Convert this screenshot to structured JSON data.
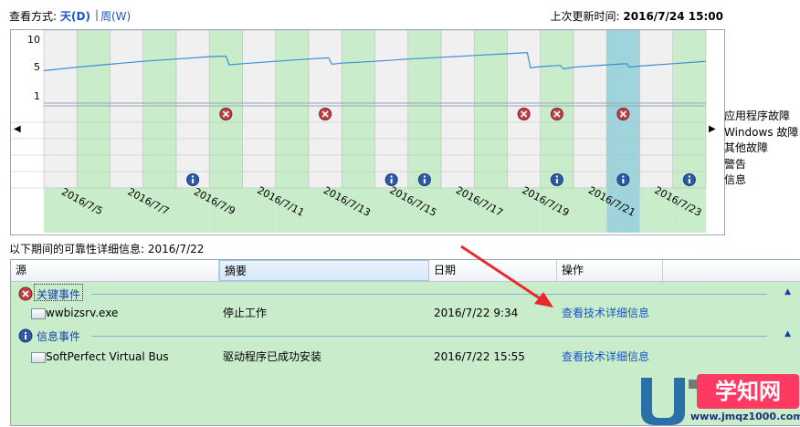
{
  "header": {
    "view_label": "查看方式:",
    "view_day": "天(D)",
    "view_sep": "|",
    "view_week": "周(W)",
    "last_update_label": "上次更新时间:",
    "last_update_value": "2016/7/24 15:00"
  },
  "chart_data": {
    "type": "line",
    "y_ticks": [
      "10",
      "5",
      "1"
    ],
    "ylim": [
      0,
      10
    ],
    "columns": 20,
    "selected_column": 17,
    "x_labels": [
      "2016/7/5",
      "2016/7/7",
      "2016/7/9",
      "2016/7/11",
      "2016/7/13",
      "2016/7/15",
      "2016/7/17",
      "2016/7/19",
      "2016/7/21",
      "2016/7/23"
    ],
    "stability_index": [
      {
        "x": 0,
        "y": 4.3
      },
      {
        "x": 1,
        "y": 4.9
      },
      {
        "x": 2,
        "y": 5.4
      },
      {
        "x": 3,
        "y": 5.9
      },
      {
        "x": 4,
        "y": 6.3
      },
      {
        "x": 5,
        "y": 6.7
      },
      {
        "x": 5.5,
        "y": 6.8
      },
      {
        "x": 5.6,
        "y": 5.3
      },
      {
        "x": 6,
        "y": 5.5
      },
      {
        "x": 7,
        "y": 5.9
      },
      {
        "x": 8,
        "y": 6.3
      },
      {
        "x": 8.6,
        "y": 6.5
      },
      {
        "x": 8.7,
        "y": 5.4
      },
      {
        "x": 9,
        "y": 5.6
      },
      {
        "x": 10,
        "y": 5.9
      },
      {
        "x": 11,
        "y": 6.3
      },
      {
        "x": 12,
        "y": 6.6
      },
      {
        "x": 13,
        "y": 6.9
      },
      {
        "x": 14,
        "y": 7.2
      },
      {
        "x": 14.6,
        "y": 7.4
      },
      {
        "x": 14.7,
        "y": 4.8
      },
      {
        "x": 15,
        "y": 5.0
      },
      {
        "x": 15.6,
        "y": 5.2
      },
      {
        "x": 15.7,
        "y": 4.6
      },
      {
        "x": 16,
        "y": 4.9
      },
      {
        "x": 17,
        "y": 5.3
      },
      {
        "x": 17.6,
        "y": 5.5
      },
      {
        "x": 17.7,
        "y": 4.9
      },
      {
        "x": 18,
        "y": 5.1
      },
      {
        "x": 19,
        "y": 5.5
      },
      {
        "x": 20,
        "y": 5.9
      }
    ],
    "categories": [
      "应用程序故障",
      "Windows 故障",
      "其他故障",
      "警告",
      "信息"
    ],
    "app_failures": [
      5,
      8,
      14,
      15,
      17
    ],
    "info_events": [
      4,
      10,
      11,
      15,
      17,
      19
    ],
    "line_color": "#3a8fd8",
    "green_color": "#c9ecca",
    "gray_color": "#f0f0f0",
    "selected_color": "#9fd4dc"
  },
  "nav": {
    "left": "◀",
    "right": "▶"
  },
  "details": {
    "title": "以下期间的可靠性详细信息: 2016/7/22",
    "columns": [
      "源",
      "摘要",
      "日期",
      "操作"
    ],
    "groups": [
      {
        "label": "关键事件",
        "caret": "▲",
        "row": {
          "source": "wwbizsrv.exe",
          "summary": "停止工作",
          "date": "2016/7/22 9:34",
          "action": "查看技术详细信息"
        }
      },
      {
        "label": "信息事件",
        "caret": "▲",
        "row": {
          "source": "SoftPerfect Virtual Bus",
          "summary": "驱动程序已成功安装",
          "date": "2016/7/22 15:55",
          "action": "查看技术详细信息"
        }
      }
    ]
  },
  "watermark": {
    "text": "学知网",
    "url": "www.jmqz1000.com"
  }
}
